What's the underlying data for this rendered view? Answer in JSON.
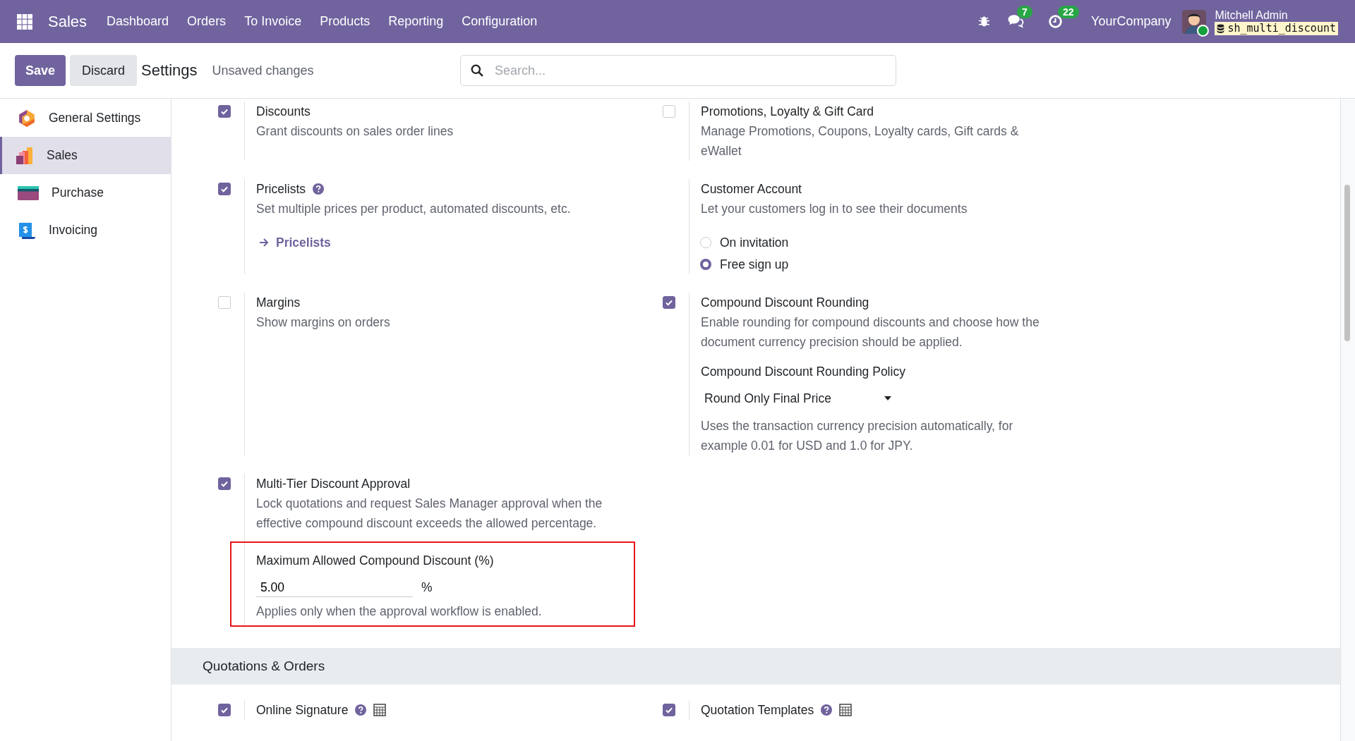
{
  "navbar": {
    "app_name": "Sales",
    "menu": [
      "Dashboard",
      "Orders",
      "To Invoice",
      "Products",
      "Reporting",
      "Configuration"
    ],
    "chat_count": "7",
    "activity_count": "22",
    "company": "YourCompany",
    "user": "Mitchell Admin",
    "database": "sh_multi_discount"
  },
  "control_panel": {
    "save": "Save",
    "discard": "Discard",
    "title": "Settings",
    "status": "Unsaved changes",
    "search": {
      "placeholder": "Search..."
    }
  },
  "sidebar": {
    "items": [
      {
        "label": "General Settings",
        "kind": "general",
        "selected": false
      },
      {
        "label": "Sales",
        "kind": "sales",
        "selected": true
      },
      {
        "label": "Purchase",
        "kind": "purchase",
        "selected": false
      },
      {
        "label": "Invoicing",
        "kind": "invoicing",
        "selected": false
      }
    ]
  },
  "settings": [
    {
      "kind": "checkbox",
      "checked": true,
      "title": "Discounts",
      "description": "Grant discounts on sales order lines"
    },
    {
      "kind": "checkbox",
      "checked": false,
      "title": "Promotions, Loyalty & Gift Card",
      "description": "Manage Promotions, Coupons, Loyalty cards, Gift cards & eWallet"
    },
    {
      "kind": "checkbox",
      "checked": true,
      "title": "Pricelists",
      "help": true,
      "description": "Set multiple prices per product, automated discounts, etc.",
      "link": "Pricelists"
    },
    {
      "kind": "plain",
      "title": "Customer Account",
      "description": "Let your customers log in to see their documents",
      "radios": [
        {
          "label": "On invitation",
          "selected": false
        },
        {
          "label": "Free sign up",
          "selected": true
        }
      ]
    },
    {
      "kind": "checkbox",
      "checked": false,
      "title": "Margins",
      "description": "Show margins on orders"
    },
    {
      "kind": "checkbox",
      "checked": true,
      "title": "Compound Discount Rounding",
      "description": "Enable rounding for compound discounts and choose how the document currency precision should be applied.",
      "sub": {
        "kind": "select",
        "highlighted": false,
        "title": "Compound Discount Rounding Policy",
        "value": "Round Only Final Price",
        "note": "Uses the transaction currency precision automatically, for example 0.01 for USD and 1.0 for JPY."
      }
    },
    {
      "kind": "checkbox",
      "checked": true,
      "title": "Multi-Tier Discount Approval",
      "description": "Lock quotations and request Sales Manager approval when the effective compound discount exceeds the allowed percentage.",
      "sub": {
        "kind": "input",
        "highlighted": true,
        "title": "Maximum Allowed Compound Discount (%)",
        "value": "5.00",
        "unit": "%",
        "note": "Applies only when the approval workflow is enabled."
      }
    },
    {
      "kind": "empty"
    }
  ],
  "sections": [
    {
      "title": "Quotations & Orders",
      "settings": [
        {
          "kind": "checkbox",
          "checked": true,
          "title": "Online Signature",
          "help": true,
          "doc_icon": true
        },
        {
          "kind": "checkbox",
          "checked": true,
          "title": "Quotation Templates",
          "help": true,
          "doc_icon": true
        }
      ]
    }
  ]
}
